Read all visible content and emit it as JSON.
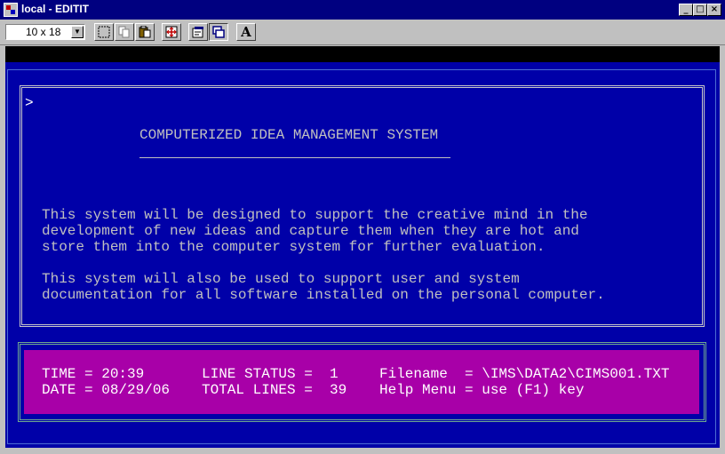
{
  "window": {
    "title": "local - EDITIT",
    "buttons": {
      "minimize": "_",
      "maximize": "□",
      "close": "×"
    }
  },
  "toolbar": {
    "font_size": "10 x 18",
    "dropdown_arrow": "▼",
    "font_button_label": "A",
    "icons": [
      "mark-icon",
      "copy-icon",
      "paste-icon",
      "fullscreen-icon",
      "properties-icon",
      "background-icon",
      "font-icon"
    ]
  },
  "screen": {
    "prompt": ">",
    "heading": "COMPUTERIZED IDEA MANAGEMENT SYSTEM",
    "paragraph1": [
      "This system will be designed to support the creative mind in the",
      "development of new ideas and capture them when they are hot and",
      "store them into the computer system for further evaluation."
    ],
    "paragraph2": [
      "This system will also be used to support user and system",
      "documentation for all software installed on the personal computer."
    ]
  },
  "status": {
    "time_label": "TIME = 20:39",
    "date_label": "DATE = 08/29/06",
    "line_status": "LINE STATUS =  1",
    "total_lines": "TOTAL LINES =  39",
    "filename": "Filename  = \\IMS\\DATA2\\CIMS001.TXT",
    "help": "Help Menu = use (F1) key"
  },
  "colors": {
    "terminal_bg": "#0000a8",
    "status_bg": "#a800a8",
    "titlebar": "#000080"
  }
}
